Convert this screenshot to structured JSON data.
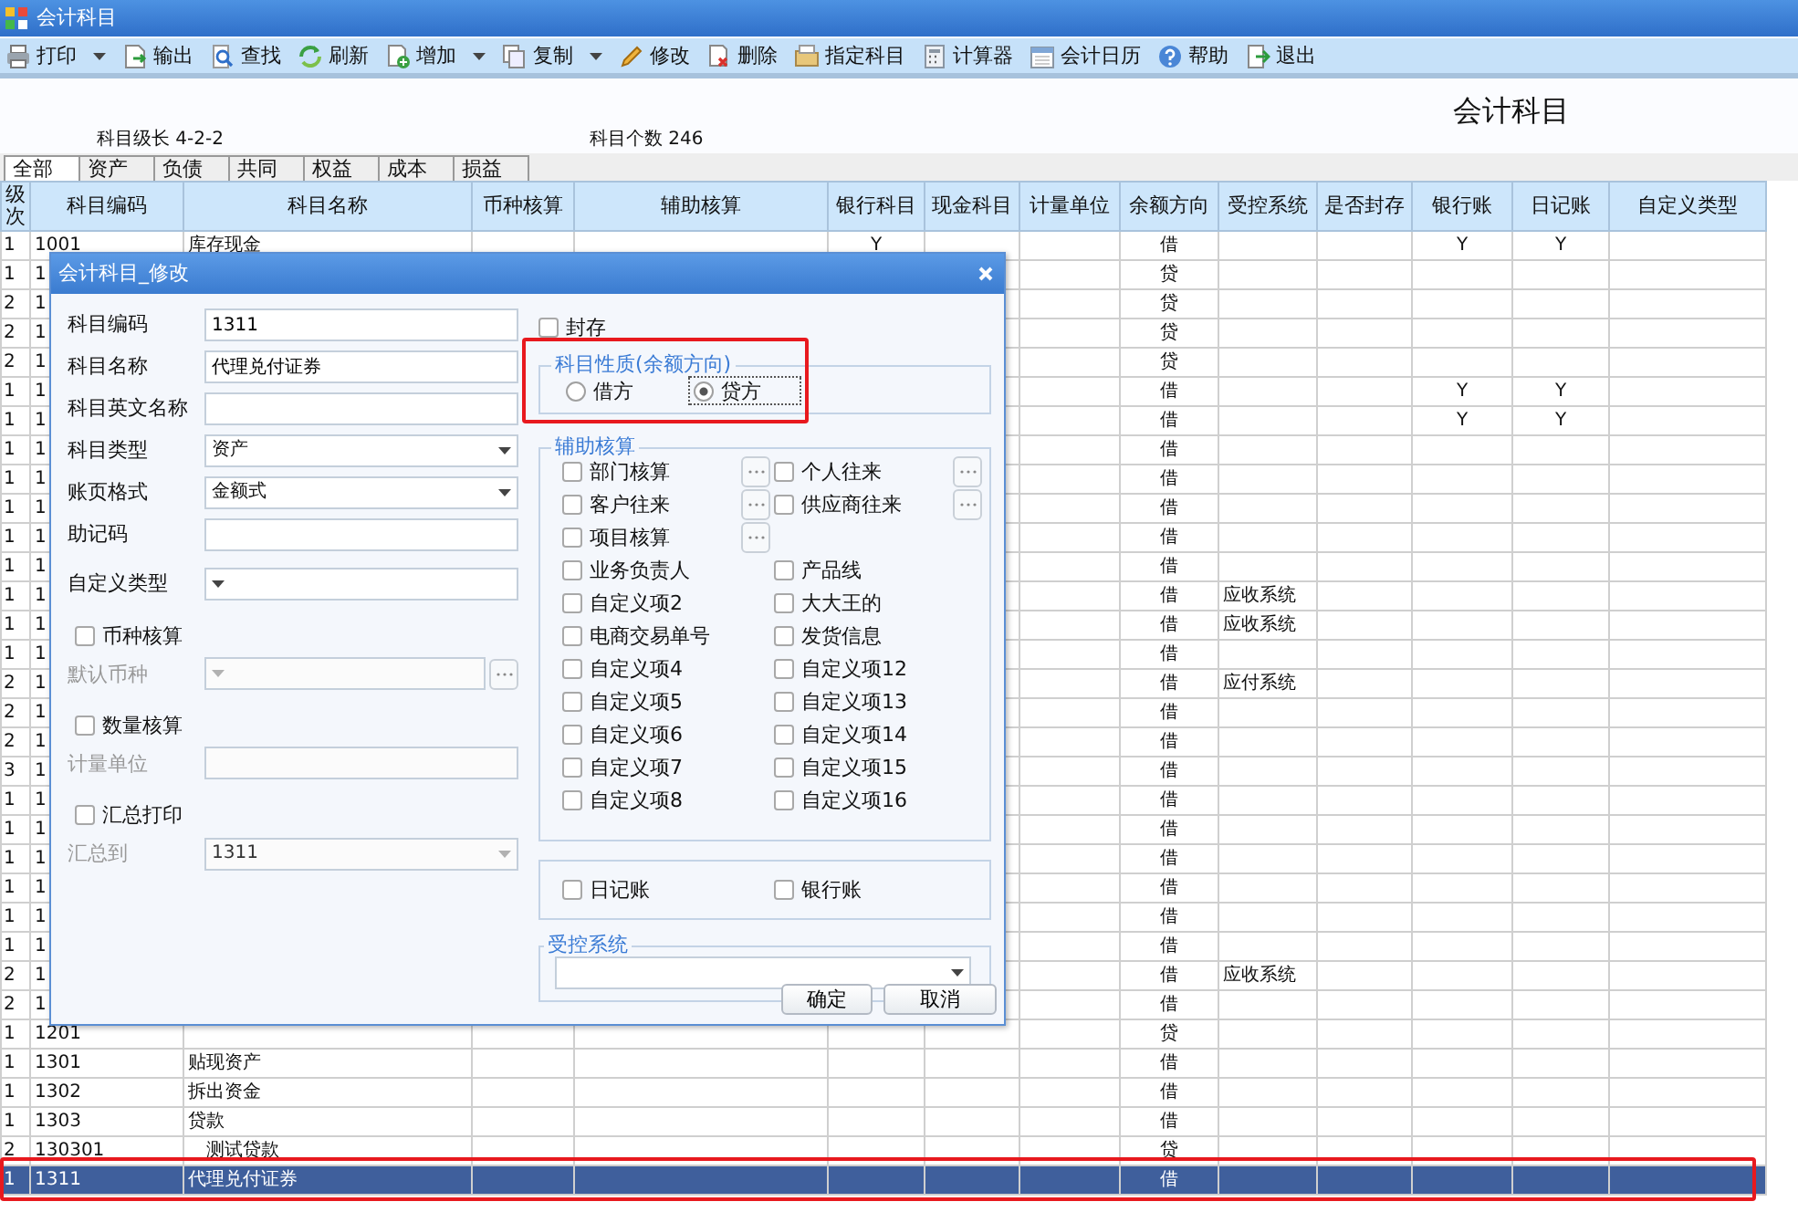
{
  "window": {
    "title": "会计科目"
  },
  "toolbar": [
    {
      "label": "打印",
      "dropdown": true
    },
    {
      "label": "输出",
      "dropdown": false
    },
    {
      "label": "查找",
      "dropdown": false
    },
    {
      "label": "刷新",
      "dropdown": false
    },
    {
      "label": "增加",
      "dropdown": true
    },
    {
      "label": "复制",
      "dropdown": true
    },
    {
      "label": "修改",
      "dropdown": false
    },
    {
      "label": "删除",
      "dropdown": false
    },
    {
      "label": "指定科目",
      "dropdown": false
    },
    {
      "label": "计算器",
      "dropdown": false
    },
    {
      "label": "会计日历",
      "dropdown": false
    },
    {
      "label": "帮助",
      "dropdown": false
    },
    {
      "label": "退出",
      "dropdown": false
    }
  ],
  "page_title": "会计科目",
  "info": [
    {
      "label": "科目级长",
      "value": "4-2-2"
    },
    {
      "label": "科目个数",
      "value": "246"
    }
  ],
  "tabs": [
    {
      "label": "全部",
      "selected": true
    },
    {
      "label": "资产",
      "selected": false
    },
    {
      "label": "负债",
      "selected": false
    },
    {
      "label": "共同",
      "selected": false
    },
    {
      "label": "权益",
      "selected": false
    },
    {
      "label": "成本",
      "selected": false
    },
    {
      "label": "损益",
      "selected": false
    }
  ],
  "table": {
    "columns": [
      "级次",
      "科目编码",
      "科目名称",
      "币种核算",
      "辅助核算",
      "银行科目",
      "现金科目",
      "计量单位",
      "余额方向",
      "受控系统",
      "是否封存",
      "银行账",
      "日记账",
      "自定义类型"
    ],
    "rows": [
      {
        "grade": "1",
        "code": "1001",
        "name": "库存现金",
        "bank_account": "Y",
        "direction": "借",
        "bank_book": "Y",
        "journal": "Y",
        "selected": false
      },
      {
        "grade": "1",
        "code": "1",
        "direction": "贷",
        "selected": false
      },
      {
        "grade": "2",
        "code": "1",
        "direction": "贷",
        "selected": false
      },
      {
        "grade": "2",
        "code": "1",
        "direction": "贷",
        "selected": false
      },
      {
        "grade": "2",
        "code": "1",
        "direction": "贷",
        "selected": false
      },
      {
        "grade": "1",
        "code": "1",
        "direction": "借",
        "bank_book": "Y",
        "journal": "Y",
        "selected": false
      },
      {
        "grade": "1",
        "code": "1",
        "direction": "借",
        "bank_book": "Y",
        "journal": "Y",
        "selected": false
      },
      {
        "grade": "1",
        "code": "1",
        "direction": "借",
        "selected": false
      },
      {
        "grade": "1",
        "code": "1",
        "direction": "借",
        "selected": false
      },
      {
        "grade": "1",
        "code": "1",
        "direction": "借",
        "selected": false
      },
      {
        "grade": "1",
        "code": "1",
        "direction": "借",
        "selected": false
      },
      {
        "grade": "1",
        "code": "1",
        "direction": "借",
        "selected": false
      },
      {
        "grade": "1",
        "code": "1",
        "direction": "借",
        "controlled_system": "应收系统",
        "selected": false
      },
      {
        "grade": "1",
        "code": "1",
        "direction": "借",
        "controlled_system": "应收系统",
        "selected": false
      },
      {
        "grade": "1",
        "code": "1",
        "direction": "借",
        "selected": false
      },
      {
        "grade": "2",
        "code": "1",
        "direction": "借",
        "controlled_system": "应付系统",
        "selected": false
      },
      {
        "grade": "2",
        "code": "1",
        "direction": "借",
        "selected": false
      },
      {
        "grade": "2",
        "code": "1",
        "direction": "借",
        "selected": false
      },
      {
        "grade": "3",
        "code": "1",
        "direction": "借",
        "selected": false
      },
      {
        "grade": "1",
        "code": "1",
        "direction": "借",
        "selected": false
      },
      {
        "grade": "1",
        "code": "1",
        "direction": "借",
        "selected": false
      },
      {
        "grade": "1",
        "code": "1",
        "direction": "借",
        "selected": false
      },
      {
        "grade": "1",
        "code": "1",
        "direction": "借",
        "selected": false
      },
      {
        "grade": "1",
        "code": "1",
        "direction": "借",
        "selected": false
      },
      {
        "grade": "1",
        "code": "1",
        "direction": "借",
        "selected": false
      },
      {
        "grade": "2",
        "code": "1",
        "direction": "借",
        "controlled_system": "应收系统",
        "selected": false
      },
      {
        "grade": "2",
        "code": "1",
        "direction": "借",
        "selected": false
      },
      {
        "grade": "1",
        "code": "1201",
        "direction": "贷",
        "selected": false
      },
      {
        "grade": "1",
        "code": "1301",
        "name": "贴现资产",
        "direction": "借",
        "selected": false
      },
      {
        "grade": "1",
        "code": "1302",
        "name": "拆出资金",
        "direction": "借",
        "selected": false
      },
      {
        "grade": "1",
        "code": "1303",
        "name": "贷款",
        "direction": "借",
        "selected": false,
        "children": [
          {
            "grade": "2",
            "code": "130301",
            "name": "测试贷款",
            "direction": "贷",
            "selected": false
          }
        ]
      },
      {
        "grade": "1",
        "code": "1311",
        "name": "代理兑付证券",
        "direction": "借",
        "selected": true
      }
    ]
  },
  "dialog": {
    "title": "会计科目_修改",
    "fields": [
      {
        "kind": "text",
        "label": "科目编码",
        "value": "1311",
        "disabled": false
      },
      {
        "kind": "text",
        "label": "科目名称",
        "value": "代理兑付证券",
        "disabled": false
      },
      {
        "kind": "text",
        "label": "科目英文名称",
        "disabled": false
      },
      {
        "kind": "select",
        "label": "科目类型",
        "value": "资产",
        "disabled": false
      },
      {
        "kind": "select",
        "label": "账页格式",
        "value": "金额式",
        "disabled": false
      },
      {
        "kind": "text",
        "label": "助记码",
        "disabled": false
      },
      {
        "kind": "select",
        "label": "自定义类型",
        "disabled": false
      },
      {
        "kind": "check",
        "label": "币种核算",
        "checked": false
      },
      {
        "kind": "select",
        "label": "默认币种",
        "disabled": true,
        "browse": true
      },
      {
        "kind": "check",
        "label": "数量核算",
        "checked": false
      },
      {
        "kind": "text",
        "label": "计量单位",
        "disabled": true
      },
      {
        "kind": "check",
        "label": "汇总打印",
        "checked": false
      },
      {
        "kind": "select",
        "label": "汇总到",
        "value": "1311",
        "disabled": true
      }
    ],
    "sealed": {
      "label": "封存",
      "checked": false
    },
    "nature": {
      "legend": "科目性质(余额方向)",
      "options": [
        {
          "label": "借方",
          "selected": false
        },
        {
          "label": "贷方",
          "selected": true
        }
      ]
    },
    "auxiliary": {
      "legend": "辅助核算",
      "rows": [
        [
          {
            "label": "部门核算",
            "checked": false,
            "browse": true
          },
          {
            "label": "个人往来",
            "checked": false,
            "browse": true
          }
        ],
        [
          {
            "label": "客户往来",
            "checked": false,
            "browse": true
          },
          {
            "label": "供应商往来",
            "checked": false,
            "browse": true
          }
        ],
        [
          {
            "label": "项目核算",
            "checked": false,
            "browse": true
          }
        ],
        [
          {
            "label": "业务负责人",
            "checked": false
          },
          {
            "label": "产品线",
            "checked": false
          }
        ],
        [
          {
            "label": "自定义项2",
            "checked": false
          },
          {
            "label": "大大王的",
            "checked": false
          }
        ],
        [
          {
            "label": "电商交易单号",
            "checked": false
          },
          {
            "label": "发货信息",
            "checked": false
          }
        ],
        [
          {
            "label": "自定义项4",
            "checked": false
          },
          {
            "label": "自定义项12",
            "checked": false
          }
        ],
        [
          {
            "label": "自定义项5",
            "checked": false
          },
          {
            "label": "自定义项13",
            "checked": false
          }
        ],
        [
          {
            "label": "自定义项6",
            "checked": false
          },
          {
            "label": "自定义项14",
            "checked": false
          }
        ],
        [
          {
            "label": "自定义项7",
            "checked": false
          },
          {
            "label": "自定义项15",
            "checked": false
          }
        ],
        [
          {
            "label": "自定义项8",
            "checked": false
          },
          {
            "label": "自定义项16",
            "checked": false
          }
        ]
      ]
    },
    "books": [
      {
        "label": "日记账",
        "checked": false
      },
      {
        "label": "银行账",
        "checked": false
      }
    ],
    "controlled_system": {
      "legend": "受控系统"
    },
    "buttons": [
      "确定",
      "取消"
    ]
  }
}
